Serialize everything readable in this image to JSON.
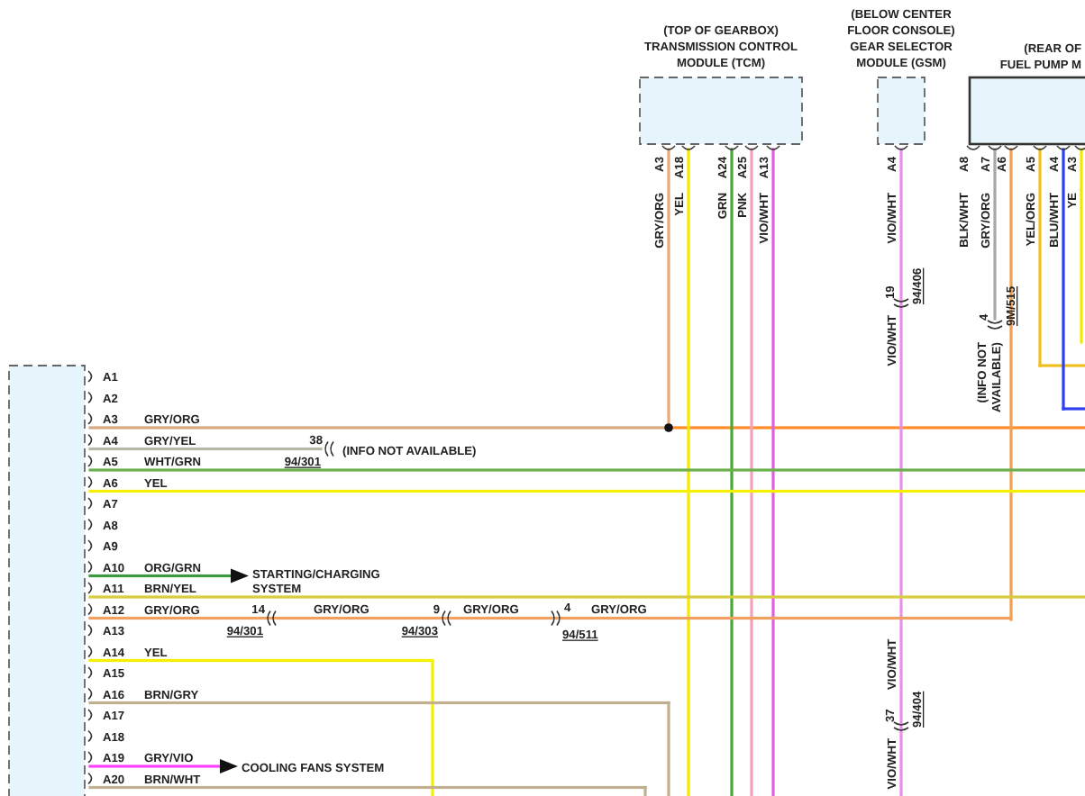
{
  "modules": [
    {
      "title_lines": [
        "(TOP OF GEARBOX)",
        "TRANSMISSION CONTROL",
        "MODULE (TCM)"
      ],
      "dashed": true,
      "pins": [
        {
          "pin": "A3",
          "wire": "GRY/ORG",
          "color": "#e8a878"
        },
        {
          "pin": "A18",
          "wire": "YEL",
          "color": "#f5e800"
        },
        {
          "pin": "A24",
          "wire": "GRN",
          "color": "#4aa832"
        },
        {
          "pin": "A25",
          "wire": "PNK",
          "color": "#f4a0b8"
        },
        {
          "pin": "A13",
          "wire": "VIO/WHT",
          "color": "#e060e0"
        }
      ]
    },
    {
      "title_lines": [
        "(BELOW CENTER",
        "FLOOR CONSOLE)",
        "GEAR SELECTOR",
        "MODULE (GSM)"
      ],
      "dashed": true,
      "pins": [
        {
          "pin": "A4",
          "wire": "VIO/WHT",
          "color": "#e890e8",
          "splices": [
            {
              "number": "19",
              "ref": "94/406",
              "wire_after": "VIO/WHT"
            },
            {
              "number": "37",
              "ref": "94/404",
              "wire_before": "VIO/WHT",
              "wire_after": "VIO/WHT"
            }
          ]
        }
      ]
    },
    {
      "title_lines": [
        "(REAR OF",
        "FUEL PUMP M"
      ],
      "dashed": false,
      "pins": [
        {
          "pin": "A8",
          "wire": "BLK/WHT"
        },
        {
          "pin": "A7",
          "wire": "GRY/ORG",
          "color": "#a8a8a8",
          "splices": [
            {
              "number": "4",
              "ref": "9M/515"
            }
          ],
          "note_lines": [
            "(INFO NOT",
            "AVAILABLE)"
          ]
        },
        {
          "pin": "A6",
          "color": "#f0a050"
        },
        {
          "pin": "A5",
          "wire": "YEL/ORG",
          "color": "#f0c020"
        },
        {
          "pin": "A4",
          "wire": "BLU/WHT",
          "color": "#3040f0"
        },
        {
          "pin": "A3",
          "wire": "YE",
          "color": "#f5e800"
        }
      ]
    }
  ],
  "left_connector": {
    "dashed": true,
    "pins": [
      {
        "pin": "A1"
      },
      {
        "pin": "A2"
      },
      {
        "pin": "A3",
        "wire": "GRY/ORG",
        "color": "#d8a880"
      },
      {
        "pin": "A4",
        "wire": "GRY/YEL",
        "color": "#b8b8a8",
        "splices": [
          {
            "number": "38",
            "ref": "94/301"
          }
        ],
        "note": "(INFO NOT AVAILABLE)"
      },
      {
        "pin": "A5",
        "wire": "WHT/GRN",
        "color": "#6ab04c"
      },
      {
        "pin": "A6",
        "wire": "YEL",
        "color": "#f5f000"
      },
      {
        "pin": "A7"
      },
      {
        "pin": "A8"
      },
      {
        "pin": "A9"
      },
      {
        "pin": "A10",
        "wire": "ORG/GRN",
        "color": "#3c9a3c",
        "destination": [
          "STARTING/CHARGING",
          "SYSTEM"
        ]
      },
      {
        "pin": "A11",
        "wire": "BRN/YEL",
        "color": "#d8cc40"
      },
      {
        "pin": "A12",
        "wire": "GRY/ORG",
        "color": "#f0a060",
        "splices": [
          {
            "number": "14",
            "ref": "94/301",
            "wire_after": "GRY/ORG"
          },
          {
            "number": "9",
            "ref": "94/303",
            "wire_after": "GRY/ORG"
          },
          {
            "number": "4",
            "ref": "94/511",
            "wire_after": "GRY/ORG"
          }
        ]
      },
      {
        "pin": "A13"
      },
      {
        "pin": "A14",
        "wire": "YEL",
        "color": "#f5f000"
      },
      {
        "pin": "A15"
      },
      {
        "pin": "A16",
        "wire": "BRN/GRY",
        "color": "#c0b090"
      },
      {
        "pin": "A17"
      },
      {
        "pin": "A18"
      },
      {
        "pin": "A19",
        "wire": "GRY/VIO",
        "color": "#ff40ff",
        "destination": [
          "COOLING FANS SYSTEM"
        ]
      },
      {
        "pin": "A20",
        "wire": "BRN/WHT",
        "color": "#c0b090"
      }
    ]
  },
  "junction": {
    "color": "#ff8c28"
  }
}
